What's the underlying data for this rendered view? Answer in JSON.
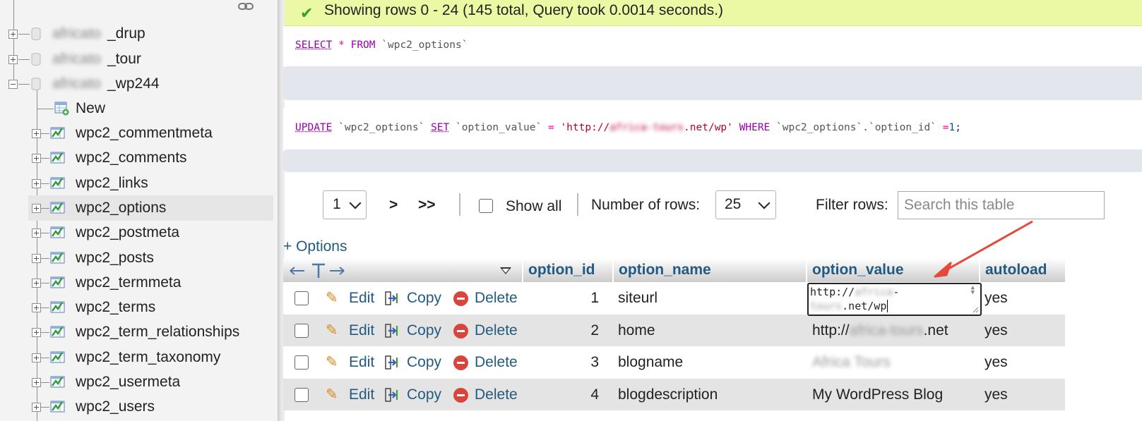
{
  "sidebar": {
    "databases": [
      {
        "prefix": "africato",
        "suffix": "_drup",
        "expanded": false
      },
      {
        "prefix": "africato",
        "suffix": "_tour",
        "expanded": false
      },
      {
        "prefix": "africato",
        "suffix": "_wp244",
        "expanded": true
      }
    ],
    "new_label": "New",
    "tables": [
      "wpc2_commentmeta",
      "wpc2_comments",
      "wpc2_links",
      "wpc2_options",
      "wpc2_postmeta",
      "wpc2_posts",
      "wpc2_termmeta",
      "wpc2_terms",
      "wpc2_term_relationships",
      "wpc2_term_taxonomy",
      "wpc2_usermeta",
      "wpc2_users"
    ],
    "selected_table": "wpc2_options"
  },
  "message": {
    "text": "Showing rows 0 - 24 (145 total, Query took 0.0014 seconds.)",
    "color": "#ebf8a4"
  },
  "sql": {
    "select": {
      "kw1": "SELECT",
      "star": "*",
      "kw2": "FROM",
      "table": "`wpc2_options`"
    },
    "update": {
      "kw1": "UPDATE",
      "table": "`wpc2_options`",
      "kw2": "SET",
      "col": "`option_value`",
      "eq": "=",
      "str_start": "'http://",
      "str_blur": "africa-tours",
      "str_end": ".net/wp'",
      "kw3": "WHERE",
      "cond": "`wpc2_options`.`option_id`",
      "eq2": "=",
      "num": "1",
      "semi": ";"
    }
  },
  "nav": {
    "page": "1",
    "next": ">",
    "last": ">>",
    "show_all": "Show all",
    "rows_label": "Number of rows:",
    "rows_value": "25",
    "filter_label": "Filter rows:",
    "filter_placeholder": "Search this table"
  },
  "table": {
    "options_link": "+ Options",
    "columns": [
      "option_id",
      "option_name",
      "option_value",
      "autoload"
    ],
    "actions": {
      "edit": "Edit",
      "copy": "Copy",
      "delete": "Delete"
    },
    "rows": [
      {
        "option_id": "1",
        "option_name": "siteurl",
        "option_value": "",
        "autoload": "yes"
      },
      {
        "option_id": "2",
        "option_name": "home",
        "option_value": "http://",
        "option_value_blur": "africa-tours",
        "option_value_end": ".net",
        "autoload": "yes"
      },
      {
        "option_id": "3",
        "option_name": "blogname",
        "option_value": "",
        "option_value_blur": "Africa Tours",
        "autoload": "yes"
      },
      {
        "option_id": "4",
        "option_name": "blogdescription",
        "option_value": "My WordPress Blog",
        "autoload": "yes"
      }
    ],
    "editing": {
      "line1": "http://",
      "blur1": "africa",
      "dash": "-",
      "blur2": "tours",
      "line2_end": ".net/wp"
    }
  },
  "colors": {
    "link": "#235a81",
    "accent_arrow": "#e8473a",
    "row_even": "#e4e4e4"
  }
}
